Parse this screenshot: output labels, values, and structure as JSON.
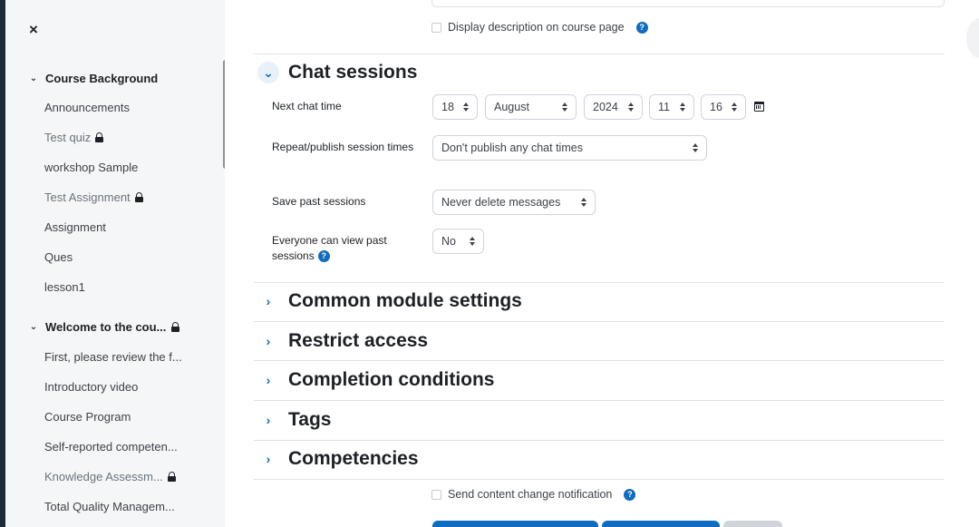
{
  "drawer": {
    "close_label": "×",
    "sections": [
      {
        "title": "Course Background",
        "items": [
          {
            "label": "Announcements",
            "locked": false
          },
          {
            "label": "Test quiz",
            "locked": true
          },
          {
            "label": "workshop Sample",
            "locked": false
          },
          {
            "label": "Test Assignment",
            "locked": true
          },
          {
            "label": "Assignment",
            "locked": false
          },
          {
            "label": "Ques",
            "locked": false
          },
          {
            "label": "lesson1",
            "locked": false
          }
        ]
      },
      {
        "title": "Welcome to the cou...",
        "locked": true,
        "items": [
          {
            "label": "First, please review the f...",
            "locked": false
          },
          {
            "label": "Introductory video",
            "locked": false
          },
          {
            "label": "Course Program",
            "locked": false
          },
          {
            "label": "Self-reported competen...",
            "locked": false
          },
          {
            "label": "Knowledge Assessm...",
            "locked": true
          },
          {
            "label": "Total Quality Managem...",
            "locked": false
          }
        ]
      }
    ]
  },
  "form": {
    "display_description_label": "Display description on course page",
    "chat_sessions": {
      "title": "Chat sessions",
      "next_chat_time_label": "Next chat time",
      "day": "18",
      "month": "August",
      "year": "2024",
      "hour": "11",
      "minute": "16",
      "repeat_label": "Repeat/publish session times",
      "repeat_value": "Don't publish any chat times",
      "save_past_label": "Save past sessions",
      "save_past_value": "Never delete messages",
      "everyone_view_label": "Everyone can view past sessions",
      "everyone_view_value": "No"
    },
    "collapsed_sections": [
      "Common module settings",
      "Restrict access",
      "Completion conditions",
      "Tags",
      "Competencies"
    ],
    "send_notification_label": "Send content change notification"
  },
  "colors": {
    "accent": "#0f6cbf",
    "drawer_bg": "#f5f6f8",
    "text": "#1d2125"
  }
}
